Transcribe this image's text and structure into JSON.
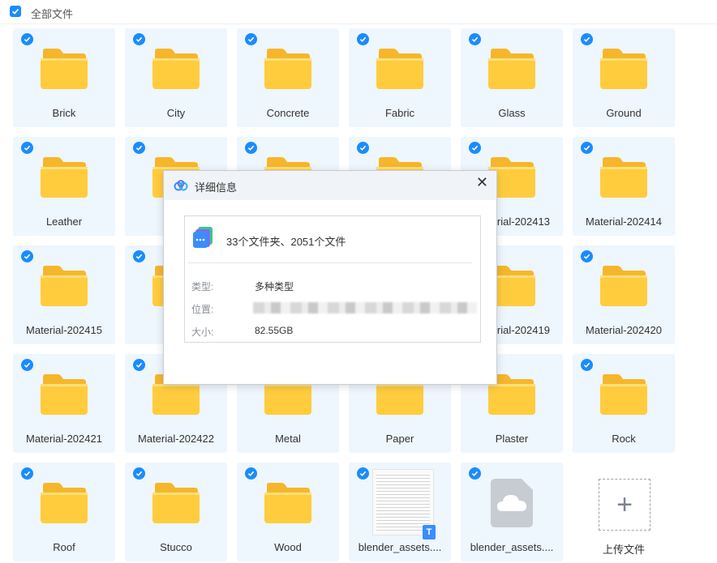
{
  "header": {
    "title": "全部文件"
  },
  "tiles": [
    {
      "type": "folder",
      "name": "Brick"
    },
    {
      "type": "folder",
      "name": "City"
    },
    {
      "type": "folder",
      "name": "Concrete"
    },
    {
      "type": "folder",
      "name": "Fabric"
    },
    {
      "type": "folder",
      "name": "Glass"
    },
    {
      "type": "folder",
      "name": "Ground"
    },
    {
      "type": "folder",
      "name": "Leather"
    },
    {
      "type": "folder",
      "name": "M"
    },
    {
      "type": "folder",
      "name": ""
    },
    {
      "type": "folder",
      "name": ""
    },
    {
      "type": "folder",
      "name": "Material-202413"
    },
    {
      "type": "folder",
      "name": "Material-202414"
    },
    {
      "type": "folder",
      "name": "Material-202415"
    },
    {
      "type": "folder",
      "name": "Mate"
    },
    {
      "type": "folder",
      "name": ""
    },
    {
      "type": "folder",
      "name": ""
    },
    {
      "type": "folder",
      "name": "Material-202419"
    },
    {
      "type": "folder",
      "name": "Material-202420"
    },
    {
      "type": "folder",
      "name": "Material-202421"
    },
    {
      "type": "folder",
      "name": "Material-202422"
    },
    {
      "type": "folder",
      "name": "Metal"
    },
    {
      "type": "folder",
      "name": "Paper"
    },
    {
      "type": "folder",
      "name": "Plaster"
    },
    {
      "type": "folder",
      "name": "Rock"
    },
    {
      "type": "folder",
      "name": "Roof"
    },
    {
      "type": "folder",
      "name": "Stucco"
    },
    {
      "type": "folder",
      "name": "Wood"
    },
    {
      "type": "doc",
      "name": "blender_assets....",
      "badge": "T"
    },
    {
      "type": "cloud",
      "name": "blender_assets...."
    },
    {
      "type": "upload",
      "name": "上传文件"
    }
  ],
  "dialog": {
    "title": "详细信息",
    "close": "✕",
    "summary": "33个文件夹、2051个文件",
    "type_label": "类型:",
    "type_value": "多种类型",
    "location_label": "位置:",
    "size_label": "大小:",
    "size_value": "82.55GB"
  },
  "colors": {
    "accent": "#1a8cff",
    "tile_bg": "#eef6fe",
    "folder": "#ffc933"
  }
}
